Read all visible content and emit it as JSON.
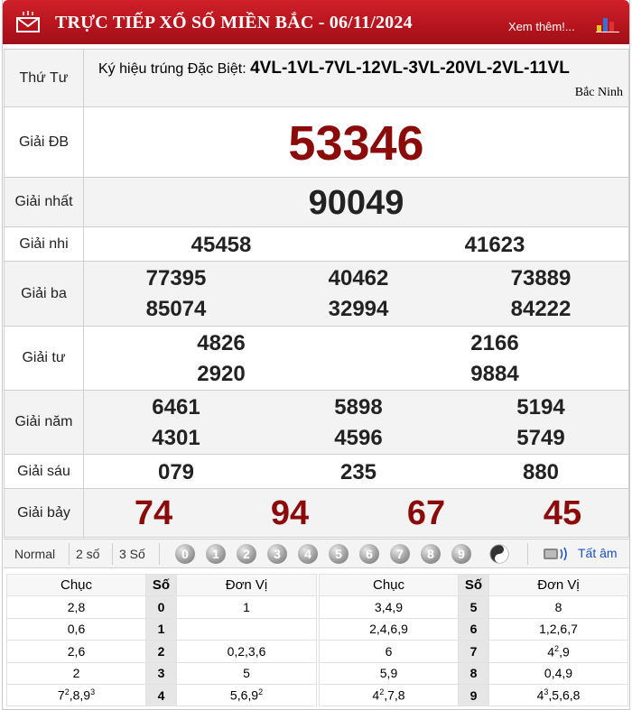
{
  "header": {
    "title": "TRỰC TIẾP XỔ SỐ MIỀN BẮC - 06/11/2024",
    "more_link": "Xem thêm!...",
    "colors": {
      "header_bg": "#b5141d",
      "prize_red": "#8b0a0a",
      "link_blue": "#1a4fd0"
    },
    "icons": [
      "mail-icon",
      "bar-chart-icon"
    ]
  },
  "day": "Thứ Tư",
  "symbol": {
    "label": "Ký hiệu trúng Đặc Biệt:",
    "codes": "4VL-1VL-7VL-12VL-3VL-20VL-2VL-11VL",
    "province": "Bắc Ninh"
  },
  "prizes": {
    "db": {
      "label": "Giải ĐB",
      "numbers": [
        "53346"
      ]
    },
    "g1": {
      "label": "Giải nhất",
      "numbers": [
        "90049"
      ]
    },
    "g2": {
      "label": "Giải nhi",
      "numbers": [
        "45458",
        "41623"
      ]
    },
    "g3": {
      "label": "Giải ba",
      "numbers": [
        "77395",
        "40462",
        "73889",
        "85074",
        "32994",
        "84222"
      ]
    },
    "g4": {
      "label": "Giải tư",
      "numbers": [
        "4826",
        "2166",
        "2920",
        "9884"
      ]
    },
    "g5": {
      "label": "Giải năm",
      "numbers": [
        "6461",
        "5898",
        "5194",
        "4301",
        "4596",
        "5749"
      ]
    },
    "g6": {
      "label": "Giải sáu",
      "numbers": [
        "079",
        "235",
        "880"
      ]
    },
    "g7": {
      "label": "Giải bảy",
      "numbers": [
        "74",
        "94",
        "67",
        "45"
      ]
    }
  },
  "toolbar": {
    "modes": [
      "Normal",
      "2 số",
      "3 Số"
    ],
    "digit_buttons": [
      "0",
      "1",
      "2",
      "3",
      "4",
      "5",
      "6",
      "7",
      "8",
      "9"
    ],
    "all_sound": "Tất âm",
    "icons": [
      "yin-yang-icon",
      "speaker-icon"
    ]
  },
  "loto": {
    "headers": {
      "chuc": "Chục",
      "so": "Số",
      "donvi": "Đơn Vị"
    },
    "left": [
      {
        "chuc": "2,8",
        "so": "0",
        "donvi": "1"
      },
      {
        "chuc": "0,6",
        "so": "1",
        "donvi": ""
      },
      {
        "chuc": "2,6",
        "so": "2",
        "donvi": "0,2,3,6"
      },
      {
        "chuc": "2",
        "so": "3",
        "donvi": "5"
      },
      {
        "chuc": "7<sup>2</sup>,8,9<sup>3</sup>",
        "so": "4",
        "donvi": "5,6,9<sup>2</sup>"
      }
    ],
    "right": [
      {
        "chuc": "3,4,9",
        "so": "5",
        "donvi": "8"
      },
      {
        "chuc": "2,4,6,9",
        "so": "6",
        "donvi": "1,2,6,7"
      },
      {
        "chuc": "6",
        "so": "7",
        "donvi": "4<sup>2</sup>,9"
      },
      {
        "chuc": "5,9",
        "so": "8",
        "donvi": "0,4,9"
      },
      {
        "chuc": "4<sup>2</sup>,7,8",
        "so": "9",
        "donvi": "4<sup>3</sup>,5,6,8"
      }
    ]
  }
}
